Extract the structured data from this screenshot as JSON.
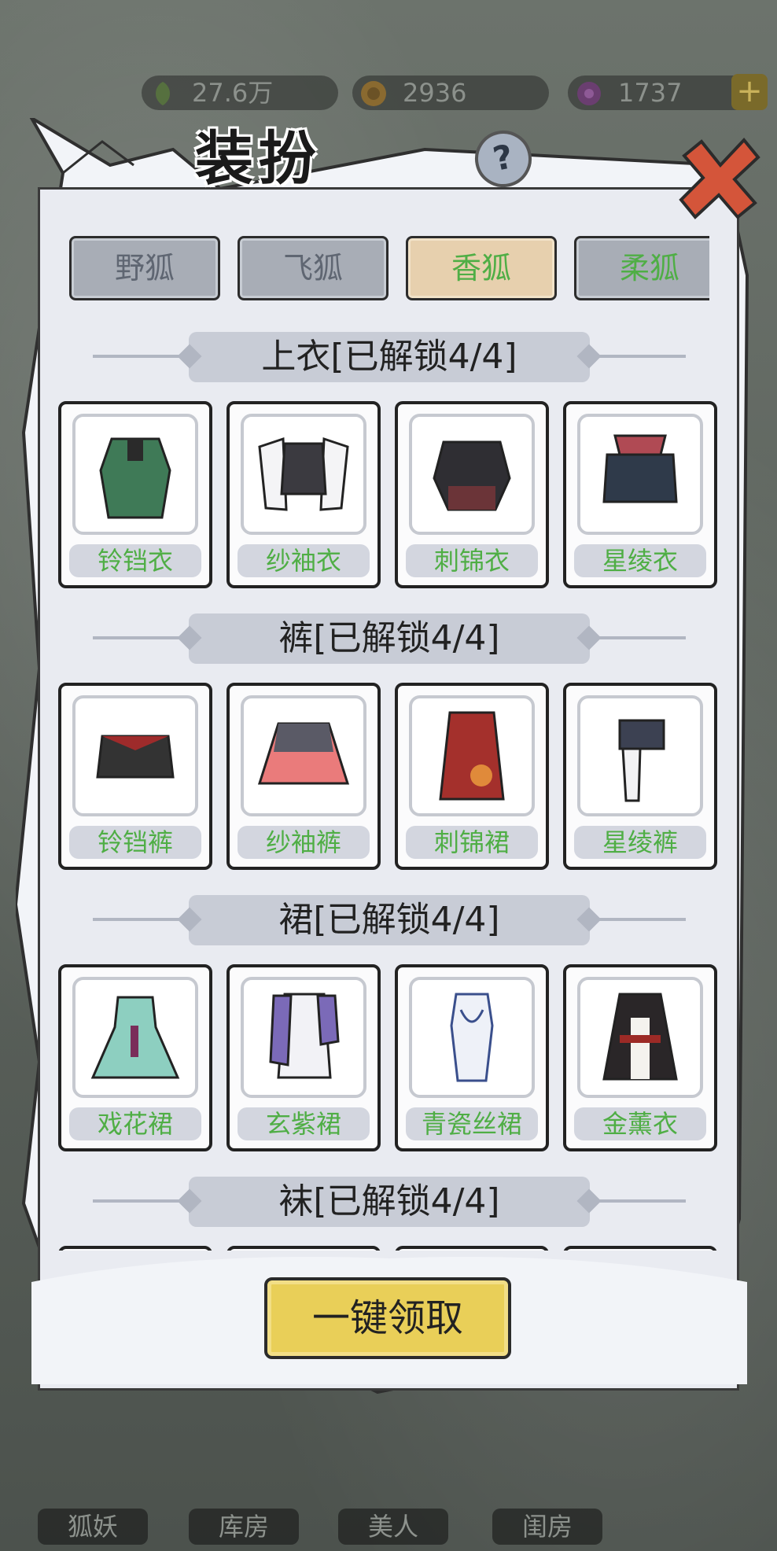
{
  "resources": {
    "leaf": "27.6万",
    "coin": "2936",
    "gem": "1737",
    "plus_label": "+"
  },
  "bottom_nav": [
    "狐妖",
    "库房",
    "美人",
    "闺房"
  ],
  "window": {
    "title": "装扮",
    "help_label": "?",
    "close_icon": "close-x-icon"
  },
  "tabs": [
    {
      "label": "野狐",
      "state": "normal"
    },
    {
      "label": "飞狐",
      "state": "normal"
    },
    {
      "label": "香狐",
      "state": "active"
    },
    {
      "label": "柔狐",
      "state": "normal"
    }
  ],
  "sections": [
    {
      "title": "上衣[已解锁4/4]",
      "items": [
        "铃铛衣",
        "纱袖衣",
        "刺锦衣",
        "星绫衣"
      ]
    },
    {
      "title": "裤[已解锁4/4]",
      "items": [
        "铃铛裤",
        "纱袖裤",
        "刺锦裙",
        "星绫裤"
      ]
    },
    {
      "title": "裙[已解锁4/4]",
      "items": [
        "戏花裙",
        "玄紫裙",
        "青瓷丝裙",
        "金薰衣"
      ]
    },
    {
      "title": "袜[已解锁4/4]",
      "items": []
    }
  ],
  "claim_button": "一键领取",
  "colors": {
    "panel": "#e9ebf1",
    "item_name_green": "#4fae45",
    "active_tab": "#e7d0ae",
    "claim_button": "#e9cf58",
    "close_red": "#d4553a"
  }
}
